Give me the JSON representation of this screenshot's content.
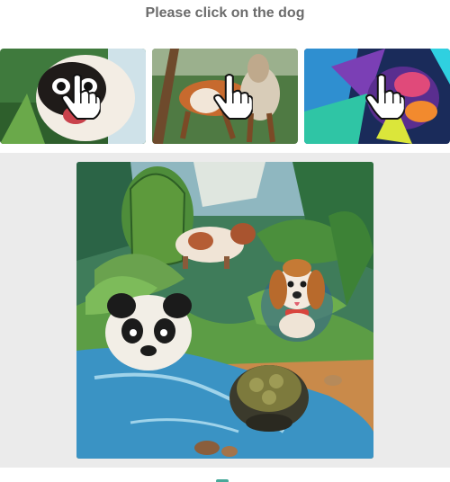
{
  "prompt": {
    "text": "Please click on the dog"
  },
  "examples": [
    {
      "subject": "pug",
      "icon": "hand-pointer-icon"
    },
    {
      "subject": "dog-running",
      "icon": "hand-pointer-icon"
    },
    {
      "subject": "colorful-dog",
      "icon": "hand-pointer-icon"
    }
  ],
  "puzzle": {
    "animals": [
      "cow",
      "beagle-dog",
      "panda",
      "tortoise"
    ],
    "target": "beagle-dog"
  },
  "colors": {
    "title": "#6b6b6b",
    "panel_bg": "#ebebeb",
    "accent": "#48a999"
  }
}
